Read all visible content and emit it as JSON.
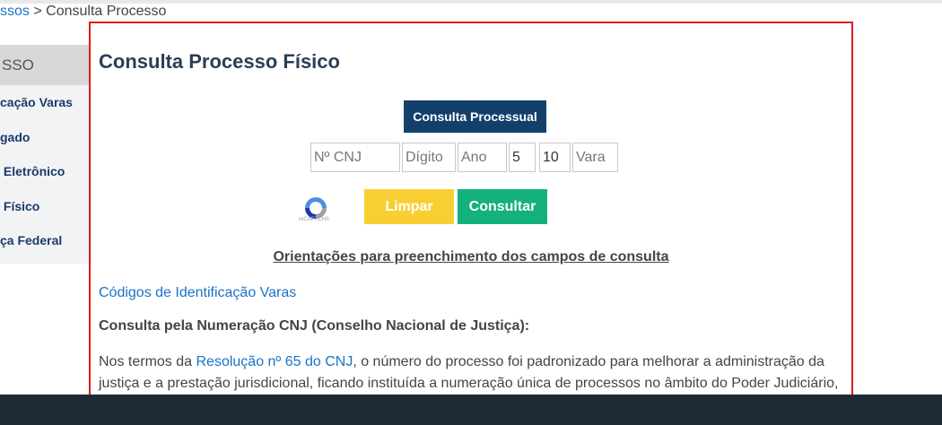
{
  "breadcrumb": {
    "parent": "ssos",
    "separator": " > ",
    "current": "Consulta Processo"
  },
  "sidebar": {
    "header": "SSO",
    "items": [
      {
        "label": "cação Varas"
      },
      {
        "label": "gado"
      },
      {
        "label": " Eletrônico"
      },
      {
        "label": " Físico"
      },
      {
        "label": "ça Federal"
      }
    ]
  },
  "main": {
    "title": "Consulta Processo Físico",
    "tab_button": "Consulta Processual",
    "fields": {
      "cnj_placeholder": "Nº CNJ",
      "digito_placeholder": "Dígito",
      "ano_placeholder": "Ano",
      "segmento_value": "5",
      "tribunal_value": "10",
      "vara_placeholder": "Vara"
    },
    "recaptcha_text": "reCAPTCHA",
    "limpar_label": "Limpar",
    "consultar_label": "Consultar",
    "orientacoes": "Orientações para preenchimento dos campos de consulta",
    "codigos_link": "Códigos de Identificação Varas",
    "subheading": "Consulta pela Numeração CNJ (Conselho Nacional de Justiça):",
    "paragraph": {
      "prefix": "Nos termos da ",
      "link": "Resolução nº 65 do CNJ",
      "suffix": ", o número do processo foi padronizado para melhorar a administração da justiça e a prestação jurisdicional, ficando instituída a numeração única de processos no âmbito do Poder Judiciário,"
    }
  },
  "colors": {
    "title": "#2b3e57",
    "tab_button_bg": "#12406b",
    "limpar_bg": "#f8cf32",
    "consultar_bg": "#14b07e",
    "panel_border": "#dd1c1c",
    "link": "#1a73c8"
  }
}
